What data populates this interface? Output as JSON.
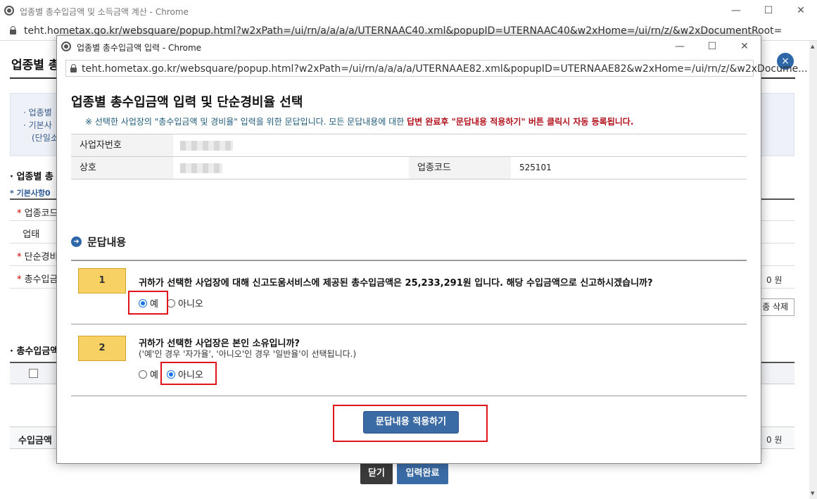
{
  "bg_window": {
    "title": "업종별 총수입금액 및 소득금액 계산 - Chrome",
    "url": "teht.hometax.go.kr/websquare/popup.html?w2xPath=/ui/rn/a/a/a/a/UTERNAAC40.xml&popupID=UTERNAAC40&w2xHome=/ui/rn/z/&w2xDocumentRoot="
  },
  "bg_page": {
    "heading": "업종별 총",
    "close_icon": "×",
    "info_lines": [
      "· 업종별",
      "· 기본사",
      "(단일소"
    ],
    "section1": "· 업종별 총",
    "sub1": "* 기본사항0",
    "rows": [
      {
        "label": "업종코드",
        "required": true
      },
      {
        "label": "업태",
        "required": false
      },
      {
        "label": "단순경비",
        "required": true
      },
      {
        "label": "총수입금",
        "required": true
      }
    ],
    "won1": "0 원",
    "section2": "· 총수입금액",
    "delete_button": "종 삭제",
    "bottom_row_label": "수입금액",
    "won2": "0 원",
    "close_button": "닫기",
    "complete_button": "입력완료"
  },
  "popup": {
    "window_title": "업종별 총수입금액 입력 - Chrome",
    "url": "teht.hometax.go.kr/websquare/popup.html?w2xPath=/ui/rn/a/a/a/a/UTERNAAE82.xml&popupID=UTERNAAE82&w2xHome=/ui/rn/z/&w2xDocume...",
    "title": "업종별 총수입금액 입력 및 단순경비율 선택",
    "notice_part1": "※ 선택한 사업장의 \"총수입금액 및 경비율\" 입력을 위한 문답입니다. 모든 문답내용에 대한 ",
    "notice_part2": "답변 완료후 \"문답내용 적용하기\" 버튼 클릭시 자동 등록됩니다.",
    "info": {
      "biz_no_label": "사업자번호",
      "trade_name_label": "상호",
      "industry_code_label": "업종코드",
      "industry_code_value": "525101"
    },
    "qa_title": "문답내용",
    "questions": [
      {
        "num": "1",
        "text": "귀하가 선택한 사업장에 대해 신고도움서비스에 제공된 총수입금액은 25,233,291원 입니다. 해당 수입금액으로 신고하시겠습니까?",
        "sub": "",
        "yes": "예",
        "no": "아니오",
        "selected": "yes"
      },
      {
        "num": "2",
        "text": "귀하가 선택한 사업장은 본인 소유입니까?",
        "sub": "('예'인 경우 '자가율', '아니오'인 경우 '일반율'이 선택됩니다.)",
        "yes": "예",
        "no": "아니오",
        "selected": "no"
      }
    ],
    "apply_button": "문답내용 적용하기"
  },
  "colors": {
    "highlight_red": "#e0151b",
    "primary_blue": "#3b6ba5",
    "question_badge": "#f7d164"
  }
}
